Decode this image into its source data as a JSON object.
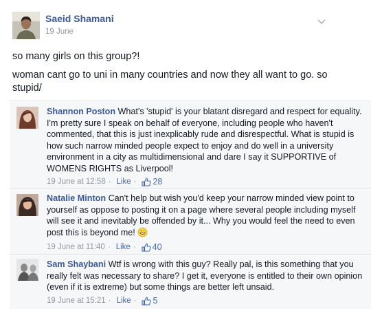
{
  "post": {
    "author": "Saeid Shamani",
    "date": "19 June",
    "line1": "so many girls on this group?!",
    "line2": "woman cant go to uni in many countries and now they all want to go. so stupid/"
  },
  "comments": [
    {
      "name": "Shannon Poston",
      "text": "What's 'stupid' is your blatant disregard and respect for equality. I'm pretty sure I speak on behalf of everyone, including people who haven't commented, that this is just inexplicably rude and disrespectful. What is stupid is how such narrow minded people expect to enjoy and do well in a university environment in a city as multidimensional and dare I say it SUPPORTIVE of WOMENS RIGHTS as Liverpool!",
      "timestamp": "19 June at 12:58",
      "like_label": "Like",
      "likes": "28"
    },
    {
      "name": "Natalie Minton",
      "text": "Can't help but wish you'd keep your narrow minded view point to yourself as oppose to posting it on a page where several people including myself will see it and inevitably be offended by it... Why you would feel the need to even post this is beyond me!",
      "emoji": "grinning-emoji",
      "timestamp": "19 June at 11:40",
      "like_label": "Like",
      "likes": "40"
    },
    {
      "name": "Sam Shaybani",
      "text": "Wtf is wrong with this guy? Really pal, is this something that you really felt was necessary to share? I get it, everyone is entitled to their own opinion (even if it is extreme) but some things are better left unsaid.",
      "timestamp": "19 June at 15:21",
      "like_label": "Like",
      "likes": "5"
    }
  ],
  "icons": {
    "post_menu": "chevron-down-icon",
    "like": "thumbs-up-icon"
  },
  "colors": {
    "link": "#3b5998",
    "meta": "#9197a3",
    "comment_bg": "#f6f7f9",
    "like_count": "#4b6aab"
  }
}
